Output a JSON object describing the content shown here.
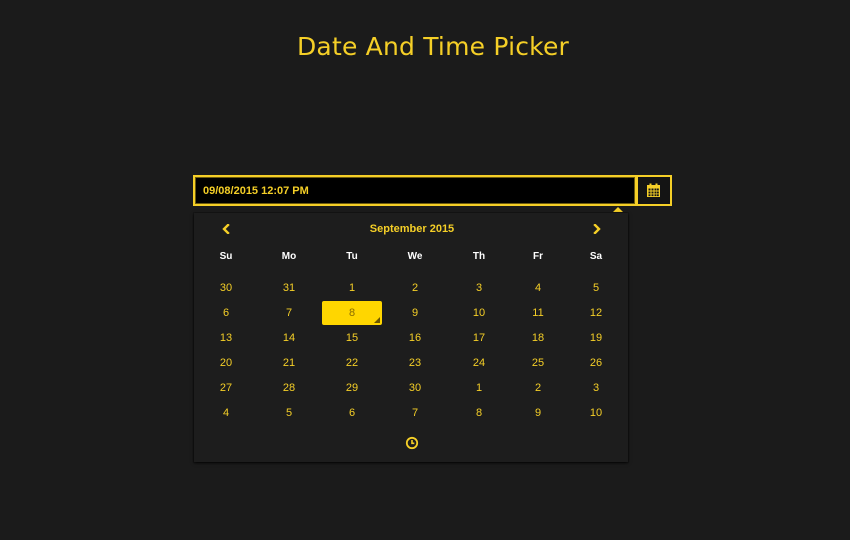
{
  "page": {
    "title": "Date And Time Picker"
  },
  "input": {
    "value": "09/08/2015 12:07 PM"
  },
  "calendar_button": {
    "icon": "calendar-icon"
  },
  "picker": {
    "month_label": "September 2015",
    "prev_icon": "chevron-left-icon",
    "next_icon": "chevron-right-icon",
    "time_icon": "clock-icon",
    "weekdays": [
      "Su",
      "Mo",
      "Tu",
      "We",
      "Th",
      "Fr",
      "Sa"
    ],
    "weeks": [
      [
        "30",
        "31",
        "1",
        "2",
        "3",
        "4",
        "5"
      ],
      [
        "6",
        "7",
        "8",
        "9",
        "10",
        "11",
        "12"
      ],
      [
        "13",
        "14",
        "15",
        "16",
        "17",
        "18",
        "19"
      ],
      [
        "20",
        "21",
        "22",
        "23",
        "24",
        "25",
        "26"
      ],
      [
        "27",
        "28",
        "29",
        "30",
        "1",
        "2",
        "3"
      ],
      [
        "4",
        "5",
        "6",
        "7",
        "8",
        "9",
        "10"
      ]
    ],
    "selected": {
      "week": 1,
      "day": 2
    }
  },
  "colors": {
    "accent": "#f5cf27",
    "background": "#1b1b1b",
    "selected_bg": "#ffd600"
  }
}
